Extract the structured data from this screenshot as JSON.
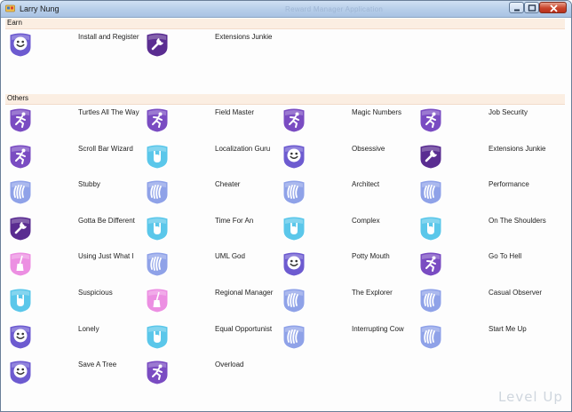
{
  "window": {
    "title": "Larry Nung",
    "faded_title": "Reward Manager Application",
    "controls": [
      "minimize",
      "maximize",
      "close"
    ]
  },
  "sections": {
    "earn": {
      "label": "Earn",
      "items": [
        {
          "label": "Install and Register",
          "icon": "smiley-badge-icon",
          "color": "#6d5bd0"
        },
        {
          "label": "Extensions Junkie",
          "icon": "wrench-badge-icon",
          "color": "#5a2d91"
        }
      ]
    },
    "others": {
      "label": "Others",
      "items": [
        {
          "label": "Turtles All The Way",
          "icon": "runner-badge-icon",
          "color": "#7a4cc2"
        },
        {
          "label": "Field Master",
          "icon": "runner-badge-icon",
          "color": "#7a4cc2"
        },
        {
          "label": "Magic Numbers",
          "icon": "runner-badge-icon",
          "color": "#7a4cc2"
        },
        {
          "label": "Job Security",
          "icon": "runner-badge-icon",
          "color": "#7a4cc2"
        },
        {
          "label": "Scroll Bar Wizard",
          "icon": "runner-badge-icon",
          "color": "#7a4cc2"
        },
        {
          "label": "Localization Guru",
          "icon": "rock-hand-badge-icon",
          "color": "#5bc7ea"
        },
        {
          "label": "Obsessive",
          "icon": "smiley-badge-icon",
          "color": "#6d5bd0"
        },
        {
          "label": "Extensions Junkie",
          "icon": "wrench-badge-icon",
          "color": "#5a2d91"
        },
        {
          "label": "Stubby",
          "icon": "claw-badge-icon",
          "color": "#8fa2e8"
        },
        {
          "label": "Cheater",
          "icon": "claw-badge-icon",
          "color": "#8fa2e8"
        },
        {
          "label": "Architect",
          "icon": "claw-badge-icon",
          "color": "#8fa2e8"
        },
        {
          "label": "Performance",
          "icon": "claw-badge-icon",
          "color": "#8fa2e8"
        },
        {
          "label": "Gotta Be Different",
          "icon": "wrench-badge-icon",
          "color": "#5a2d91"
        },
        {
          "label": "Time For An",
          "icon": "rock-hand-badge-icon",
          "color": "#5bc7ea"
        },
        {
          "label": "Complex",
          "icon": "rock-hand-badge-icon",
          "color": "#5bc7ea"
        },
        {
          "label": "On The Shoulders",
          "icon": "rock-hand-badge-icon",
          "color": "#5bc7ea"
        },
        {
          "label": "Using Just What I",
          "icon": "broom-badge-icon",
          "color": "#ec8fe2"
        },
        {
          "label": "UML God",
          "icon": "claw-badge-icon",
          "color": "#8fa2e8"
        },
        {
          "label": "Potty Mouth",
          "icon": "smiley-badge-icon",
          "color": "#6d5bd0"
        },
        {
          "label": "Go To Hell",
          "icon": "runner-badge-icon",
          "color": "#7a4cc2"
        },
        {
          "label": "Suspicious",
          "icon": "rock-hand-badge-icon",
          "color": "#5bc7ea"
        },
        {
          "label": "Regional Manager",
          "icon": "broom-badge-icon",
          "color": "#ec8fe2"
        },
        {
          "label": "The Explorer",
          "icon": "claw-badge-icon",
          "color": "#8fa2e8"
        },
        {
          "label": "Casual Observer",
          "icon": "claw-badge-icon",
          "color": "#8fa2e8"
        },
        {
          "label": "Lonely",
          "icon": "smiley-badge-icon",
          "color": "#6d5bd0"
        },
        {
          "label": "Equal Opportunist",
          "icon": "rock-hand-badge-icon",
          "color": "#5bc7ea"
        },
        {
          "label": "Interrupting Cow",
          "icon": "claw-badge-icon",
          "color": "#8fa2e8"
        },
        {
          "label": "Start Me Up",
          "icon": "claw-badge-icon",
          "color": "#8fa2e8"
        },
        {
          "label": "Save A Tree",
          "icon": "smiley-badge-icon",
          "color": "#6d5bd0"
        },
        {
          "label": "Overload",
          "icon": "runner-badge-icon",
          "color": "#7a4cc2"
        }
      ]
    }
  },
  "watermark": "Level Up"
}
